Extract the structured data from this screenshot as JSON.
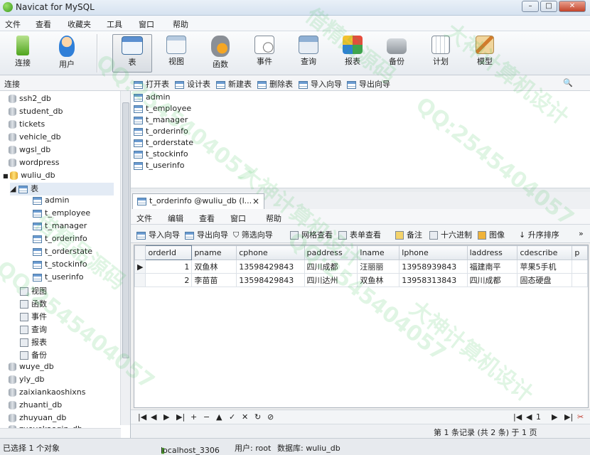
{
  "window": {
    "title": "Navicat for MySQL"
  },
  "menubar": [
    "文件",
    "查看",
    "收藏夹",
    "工具",
    "窗口",
    "帮助"
  ],
  "toolbar": [
    {
      "label": "连接",
      "icon": "connect-icon"
    },
    {
      "label": "用户",
      "icon": "user-icon"
    },
    {
      "label": "表",
      "icon": "table-icon",
      "active": true
    },
    {
      "label": "视图",
      "icon": "view-icon"
    },
    {
      "label": "函数",
      "icon": "function-icon"
    },
    {
      "label": "事件",
      "icon": "event-icon"
    },
    {
      "label": "查询",
      "icon": "query-icon"
    },
    {
      "label": "报表",
      "icon": "report-icon"
    },
    {
      "label": "备份",
      "icon": "backup-icon"
    },
    {
      "label": "计划",
      "icon": "schedule-icon"
    },
    {
      "label": "模型",
      "icon": "model-icon"
    }
  ],
  "sidebar": {
    "header": "连接",
    "databases_before": [
      "ssh2_db",
      "student_db",
      "tickets",
      "vehicle_db",
      "wgsl_db",
      "wordpress"
    ],
    "open_db": "wuliu_db",
    "table_group": "表",
    "tables": [
      "admin",
      "t_employee",
      "t_manager",
      "t_orderinfo",
      "t_orderstate",
      "t_stockinfo",
      "t_userinfo"
    ],
    "other_nodes": [
      "视图",
      "函数",
      "事件",
      "查询",
      "报表",
      "备份"
    ],
    "databases_after": [
      "wuye_db",
      "yly_db",
      "zaixiankaoshixns",
      "zhuanti_db",
      "zhuyuan_db",
      "zuoyekaoqin_db"
    ]
  },
  "objbar": [
    "打开表",
    "设计表",
    "新建表",
    "删除表",
    "导入向导",
    "导出向导"
  ],
  "objects": [
    "admin",
    "t_employee",
    "t_manager",
    "t_orderinfo",
    "t_orderstate",
    "t_stockinfo",
    "t_userinfo"
  ],
  "tab": {
    "label": "t_orderinfo @wuliu_db (l...",
    "close": "×"
  },
  "inner_menu": [
    "文件",
    "编辑",
    "查看",
    "窗口",
    "帮助"
  ],
  "data_toolbar": [
    "导入向导",
    "导出向导",
    "筛选向导",
    "网格查看",
    "表单查看",
    "备注",
    "十六进制",
    "图像",
    "升序排序"
  ],
  "grid": {
    "columns": [
      "orderId",
      "pname",
      "cphone",
      "paddress",
      "lname",
      "lphone",
      "laddress",
      "cdescribe",
      "p"
    ],
    "rows": [
      [
        "1",
        "双鱼林",
        "13598429843",
        "四川成都",
        "汪丽丽",
        "13958939843",
        "福建南平",
        "苹果5手机",
        ""
      ],
      [
        "2",
        "李苗苗",
        "13598429843",
        "四川达州",
        "双鱼林",
        "13958313843",
        "四川成都",
        "固态硬盘",
        ""
      ]
    ]
  },
  "nav": {
    "page": "1",
    "record_info": "第 1 条记录 (共 2 条) 于 1 页"
  },
  "status": {
    "selection": "已选择 1 个对象",
    "host": "localhost_3306",
    "user": "用户: root",
    "db": "数据库: wuliu_db"
  },
  "watermarks": [
    "QQ:2545404057",
    "大神计算机设计",
    "借精品源码"
  ]
}
